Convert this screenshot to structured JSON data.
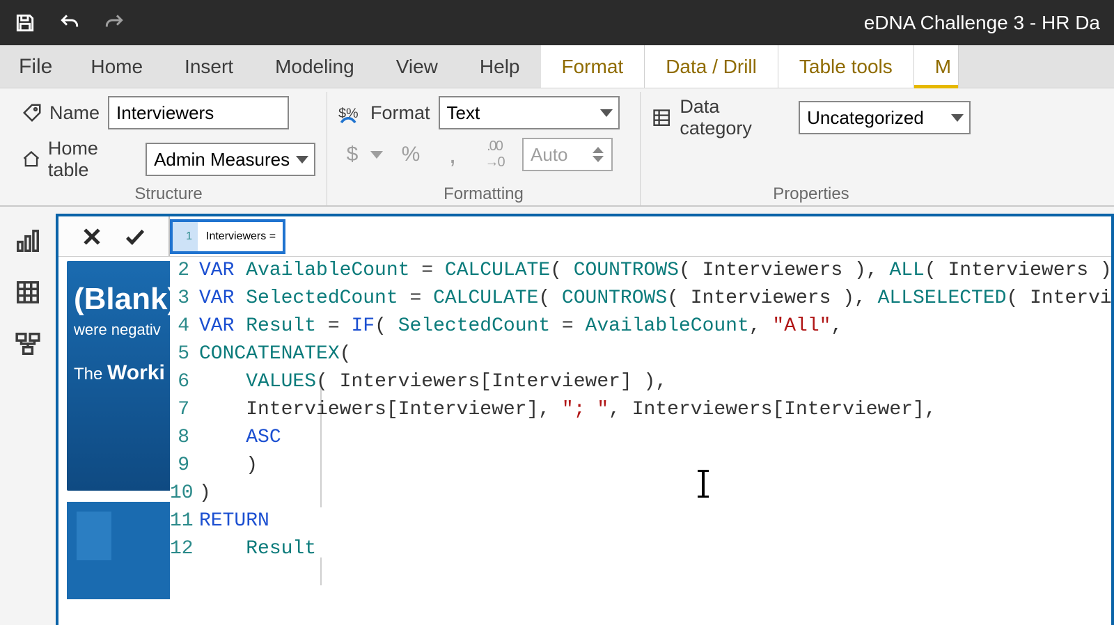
{
  "titlebar": {
    "app_title": "eDNA Challenge 3 - HR Da"
  },
  "tabs": {
    "file": "File",
    "home": "Home",
    "insert": "Insert",
    "modeling": "Modeling",
    "view": "View",
    "help": "Help",
    "format": "Format",
    "data_drill": "Data / Drill",
    "table_tools": "Table tools",
    "measure_tools": "M"
  },
  "ribbon": {
    "structure": {
      "label": "Structure",
      "name_label": "Name",
      "name_value": "Interviewers",
      "home_table_label": "Home table",
      "home_table_value": "Admin Measures"
    },
    "formatting": {
      "label": "Formatting",
      "format_label": "Format",
      "format_value": "Text",
      "decimals_value": "Auto"
    },
    "properties": {
      "label": "Properties",
      "data_category_label": "Data category",
      "data_category_value": "Uncategorized"
    }
  },
  "code": {
    "line1": "Interviewers = ",
    "lines": [
      {
        "n": "2",
        "segments": [
          {
            "t": "VAR ",
            "c": "kw"
          },
          {
            "t": "AvailableCount",
            "c": "var"
          },
          {
            "t": " = ",
            "c": "op"
          },
          {
            "t": "CALCULATE",
            "c": "fn"
          },
          {
            "t": "( ",
            "c": "op"
          },
          {
            "t": "COUNTROWS",
            "c": "fn"
          },
          {
            "t": "( ",
            "c": "op"
          },
          {
            "t": "Interviewers ",
            "c": "id"
          },
          {
            "t": "), ",
            "c": "op"
          },
          {
            "t": "ALL",
            "c": "fn"
          },
          {
            "t": "( ",
            "c": "op"
          },
          {
            "t": "Interviewers ",
            "c": "id"
          },
          {
            "t": ") )",
            "c": "op"
          }
        ]
      },
      {
        "n": "3",
        "segments": [
          {
            "t": "VAR ",
            "c": "kw"
          },
          {
            "t": "SelectedCount",
            "c": "var"
          },
          {
            "t": " = ",
            "c": "op"
          },
          {
            "t": "CALCULATE",
            "c": "fn"
          },
          {
            "t": "( ",
            "c": "op"
          },
          {
            "t": "COUNTROWS",
            "c": "fn"
          },
          {
            "t": "( ",
            "c": "op"
          },
          {
            "t": "Interviewers ",
            "c": "id"
          },
          {
            "t": "), ",
            "c": "op"
          },
          {
            "t": "ALLSELECTED",
            "c": "fn"
          },
          {
            "t": "( ",
            "c": "op"
          },
          {
            "t": "Interviewers ",
            "c": "id"
          },
          {
            "t": ") )",
            "c": "op"
          }
        ]
      },
      {
        "n": "4",
        "segments": [
          {
            "t": "VAR ",
            "c": "kw"
          },
          {
            "t": "Result",
            "c": "var"
          },
          {
            "t": " = ",
            "c": "op"
          },
          {
            "t": "IF",
            "c": "kw"
          },
          {
            "t": "( ",
            "c": "op"
          },
          {
            "t": "SelectedCount",
            "c": "var"
          },
          {
            "t": " = ",
            "c": "op"
          },
          {
            "t": "AvailableCount",
            "c": "var"
          },
          {
            "t": ", ",
            "c": "op"
          },
          {
            "t": "\"All\"",
            "c": "str"
          },
          {
            "t": ",",
            "c": "op"
          }
        ]
      },
      {
        "n": "5",
        "segments": [
          {
            "t": "CONCATENATEX",
            "c": "fn"
          },
          {
            "t": "(",
            "c": "op"
          }
        ]
      },
      {
        "n": "6",
        "segments": [
          {
            "t": "    ",
            "c": "op"
          },
          {
            "t": "VALUES",
            "c": "fn"
          },
          {
            "t": "( ",
            "c": "op"
          },
          {
            "t": "Interviewers[Interviewer] ",
            "c": "id"
          },
          {
            "t": "),",
            "c": "op"
          }
        ]
      },
      {
        "n": "7",
        "segments": [
          {
            "t": "    ",
            "c": "op"
          },
          {
            "t": "Interviewers[Interviewer]",
            "c": "id"
          },
          {
            "t": ", ",
            "c": "op"
          },
          {
            "t": "\"; \"",
            "c": "str"
          },
          {
            "t": ", ",
            "c": "op"
          },
          {
            "t": "Interviewers[Interviewer]",
            "c": "id"
          },
          {
            "t": ",",
            "c": "op"
          }
        ]
      },
      {
        "n": "8",
        "segments": [
          {
            "t": "    ",
            "c": "op"
          },
          {
            "t": "ASC",
            "c": "kw"
          }
        ]
      },
      {
        "n": "9",
        "segments": [
          {
            "t": "    )",
            "c": "op"
          }
        ]
      },
      {
        "n": "10",
        "segments": [
          {
            "t": ")",
            "c": "op"
          }
        ]
      },
      {
        "n": "11",
        "segments": [
          {
            "t": "RETURN",
            "c": "kw"
          }
        ]
      },
      {
        "n": "12",
        "segments": [
          {
            "t": "    ",
            "c": "op"
          },
          {
            "t": "Result",
            "c": "var"
          }
        ]
      }
    ]
  },
  "bgcard": {
    "big": "(Blank)",
    "sm": "were negativ",
    "mid_pre": "The ",
    "mid_bold": "Worki"
  }
}
